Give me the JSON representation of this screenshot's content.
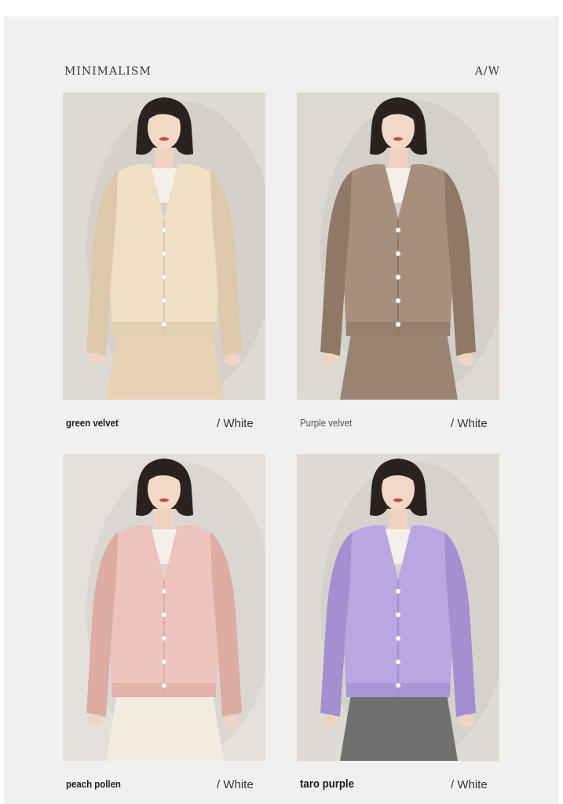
{
  "header": {
    "brand": "MINIMALISM",
    "season": "A/W"
  },
  "products": [
    {
      "name": "green velvet",
      "color_label": "/ White",
      "sweater_color": "#efdfc4",
      "sweater_shade": "#dcc9aa",
      "bottom_color": "#e6d3b6",
      "background": "#dedad3"
    },
    {
      "name": "Purple velvet",
      "color_label": "/ White",
      "sweater_color": "#a88f7c",
      "sweater_shade": "#8f7866",
      "bottom_color": "#9a8574",
      "background": "#dcd8d2"
    },
    {
      "name": "peach pollen",
      "color_label": "/ White",
      "sweater_color": "#eec3bb",
      "sweater_shade": "#ddaca3",
      "bottom_color": "#f1ebe0",
      "background": "#e3dfda"
    },
    {
      "name": "taro purple",
      "color_label": "/ White",
      "sweater_color": "#b9a6e2",
      "sweater_shade": "#a390d0",
      "bottom_color": "#6f7070",
      "background": "#dedbd7"
    }
  ]
}
